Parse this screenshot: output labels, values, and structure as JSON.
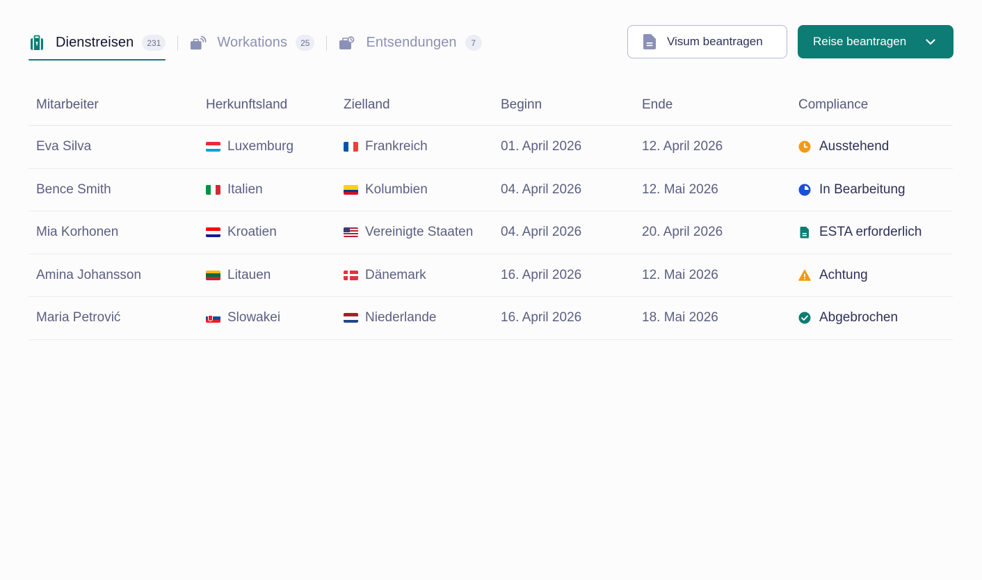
{
  "tabs": [
    {
      "label": "Dienstreisen",
      "count": "231",
      "icon": "suitcase-icon"
    },
    {
      "label": "Workations",
      "count": "25",
      "icon": "laptop-wave-icon"
    },
    {
      "label": "Entsendungen",
      "count": "7",
      "icon": "briefcase-clock-icon"
    }
  ],
  "actions": {
    "visa_label": "Visum beantragen",
    "travel_label": "Reise beantragen"
  },
  "table": {
    "headers": [
      "Mitarbeiter",
      "Herkunftsland",
      "Zielland",
      "Beginn",
      "Ende",
      "Compliance"
    ],
    "rows": [
      {
        "name": "Eva Silva",
        "origin": "Luxemburg",
        "destination": "Frankreich",
        "start": "01. April 2026",
        "end": "12. April 2026",
        "status": "Ausstehend",
        "status_icon": "clock-icon"
      },
      {
        "name": "Bence Smith",
        "origin": "Italien",
        "destination": "Kolumbien",
        "start": "04. April 2026",
        "end": "12. Mai 2026",
        "status": "In Bearbeitung",
        "status_icon": "progress-pie-icon"
      },
      {
        "name": "Mia Korhonen",
        "origin": "Kroatien",
        "destination": "Vereinigte Staaten",
        "start": "04. April 2026",
        "end": "20. April 2026",
        "status": "ESTA erforderlich",
        "status_icon": "document-icon"
      },
      {
        "name": "Amina Johansson",
        "origin": "Litauen",
        "destination": "Dänemark",
        "start": "16. April 2026",
        "end": "12. Mai 2026",
        "status": "Achtung",
        "status_icon": "warning-icon"
      },
      {
        "name": "Maria Petrović",
        "origin": "Slowakei",
        "destination": "Niederlande",
        "start": "16. April 2026",
        "end": "18. Mai 2026",
        "status": "Abgebrochen",
        "status_icon": "check-circle-icon"
      }
    ]
  },
  "colors": {
    "accent": "#0d7c74",
    "pending": "#f39a13",
    "in_progress": "#1d4fd8",
    "document": "#0d7c74",
    "warning": "#f39a13",
    "done": "#0d7c74"
  }
}
